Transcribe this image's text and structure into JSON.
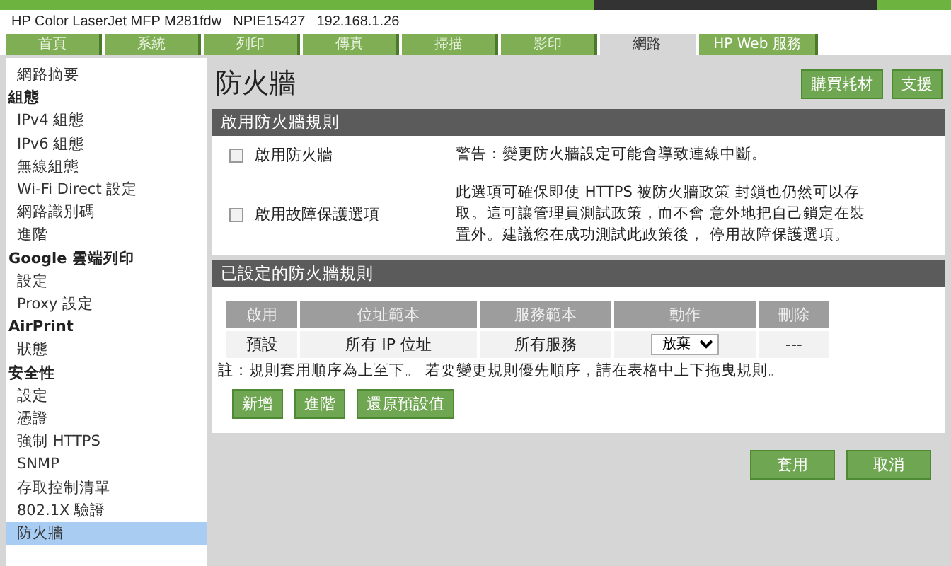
{
  "header": {
    "device": "HP Color LaserJet MFP M281fdw",
    "host": "NPIE15427",
    "ip": "192.168.1.26"
  },
  "tabs": [
    {
      "label": "首頁",
      "selected": false
    },
    {
      "label": "系統",
      "selected": false
    },
    {
      "label": "列印",
      "selected": false
    },
    {
      "label": "傳真",
      "selected": false
    },
    {
      "label": "掃描",
      "selected": false
    },
    {
      "label": "影印",
      "selected": false
    },
    {
      "label": "網路",
      "selected": true
    },
    {
      "label": "HP Web 服務",
      "selected": false
    }
  ],
  "sidebar": {
    "items": [
      {
        "kind": "item",
        "label": "網路摘要",
        "selected": false
      },
      {
        "kind": "heading",
        "label": "組態"
      },
      {
        "kind": "item",
        "label": "IPv4 組態",
        "selected": false
      },
      {
        "kind": "item",
        "label": "IPv6 組態",
        "selected": false
      },
      {
        "kind": "item",
        "label": "無線組態",
        "selected": false
      },
      {
        "kind": "item",
        "label": "Wi-Fi Direct 設定",
        "selected": false
      },
      {
        "kind": "item",
        "label": "網路識別碼",
        "selected": false
      },
      {
        "kind": "item",
        "label": "進階",
        "selected": false
      },
      {
        "kind": "heading",
        "label": "Google 雲端列印"
      },
      {
        "kind": "item",
        "label": "設定",
        "selected": false
      },
      {
        "kind": "item",
        "label": "Proxy 設定",
        "selected": false
      },
      {
        "kind": "heading",
        "label": "AirPrint"
      },
      {
        "kind": "item",
        "label": "狀態",
        "selected": false
      },
      {
        "kind": "heading",
        "label": "安全性"
      },
      {
        "kind": "item",
        "label": "設定",
        "selected": false
      },
      {
        "kind": "item",
        "label": "憑證",
        "selected": false
      },
      {
        "kind": "item",
        "label": "強制 HTTPS",
        "selected": false
      },
      {
        "kind": "item",
        "label": "SNMP",
        "selected": false
      },
      {
        "kind": "item",
        "label": "存取控制清單",
        "selected": false
      },
      {
        "kind": "item",
        "label": "802.1X 驗證",
        "selected": false
      },
      {
        "kind": "item",
        "label": "防火牆",
        "selected": true
      }
    ]
  },
  "page": {
    "title": "防火牆",
    "actions": [
      "購買耗材",
      "支援"
    ]
  },
  "enable_section": {
    "title": "啟用防火牆規則",
    "options": [
      {
        "label": "啟用防火牆",
        "checked": false,
        "description": "警告：變更防火牆設定可能會導致連線中斷。"
      },
      {
        "label": "啟用故障保護選項",
        "checked": false,
        "description": "此選項可確保即使 HTTPS 被防火牆政策 封鎖也仍然可以存取。這可讓管理員測試政策，而不會 意外地把自己鎖定在裝置外。建議您在成功測試此政策後， 停用故障保護選項。"
      }
    ]
  },
  "rules_section": {
    "title": "已設定的防火牆規則",
    "table": {
      "columns": [
        "啟用",
        "位址範本",
        "服務範本",
        "動作",
        "刪除"
      ],
      "rows": [
        {
          "enable": "預設",
          "address": "所有 IP 位址",
          "service": "所有服務",
          "action": "放棄",
          "delete": "---"
        }
      ]
    },
    "note": "註：規則套用順序為上至下。 若要變更規則優先順序，請在表格中上下拖曳規則。",
    "buttons": [
      "新增",
      "進階",
      "還原預設值"
    ]
  },
  "footer_buttons": [
    "套用",
    "取消"
  ]
}
